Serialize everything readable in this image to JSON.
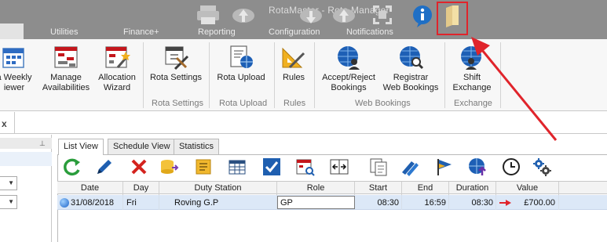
{
  "window": {
    "title": "RotaMaster - Rota Manager"
  },
  "tabs": [
    "Utilities",
    "Finance+",
    "Reporting",
    "Configuration",
    "Notifications"
  ],
  "ribbon": {
    "buttons": [
      {
        "line1": "a Weekly",
        "line2": "iewer"
      },
      {
        "line1": "Manage",
        "line2": "Availabilities"
      },
      {
        "line1": "Allocation",
        "line2": "Wizard"
      },
      {
        "line1": "Rota Settings",
        "line2": ""
      },
      {
        "line1": "Rota Upload",
        "line2": ""
      },
      {
        "line1": "Rules",
        "line2": ""
      },
      {
        "line1": "Accept/Reject",
        "line2": "Bookings"
      },
      {
        "line1": "Registrar",
        "line2": "Web Bookings"
      },
      {
        "line1": "Shift",
        "line2": "Exchange"
      }
    ],
    "groups": [
      "Rota Settings",
      "Rota Upload",
      "Rules",
      "Web Bookings",
      "Exchange"
    ]
  },
  "doc": {
    "close_glyph": "x"
  },
  "left_panel": {
    "pin_glyph": "⊥"
  },
  "view_tabs": [
    "List View",
    "Schedule View",
    "Statistics"
  ],
  "grid": {
    "headers": [
      "Date",
      "Day",
      "Duty Station",
      "Role",
      "Start",
      "End",
      "Duration",
      "Value"
    ],
    "rows": [
      {
        "date": "31/08/2018",
        "day": "Fri",
        "duty_station": "Roving G.P",
        "role": "GP",
        "start": "08:30",
        "end": "16:59",
        "duration": "08:30",
        "value": "£700.00"
      }
    ]
  },
  "colors": {
    "accent_red": "#e0242b",
    "selection": "#dce8f7",
    "ribbon_bg": "#f7f7f7",
    "titlebar": "#8d8d8d"
  },
  "icons": {
    "qat": [
      "printer-icon",
      "cloud-upload-icon",
      "cloud-download-icon",
      "cloud-upload-icon",
      "grid-focus-icon",
      "info-icon",
      "folder-icon"
    ],
    "toolbar": [
      "refresh-icon",
      "edit-icon",
      "delete-icon",
      "database-export-icon",
      "document-list-icon",
      "table-icon",
      "checkbox-icon",
      "calendar-search-icon",
      "swap-columns-icon",
      "copy-icon",
      "edit-multiple-icon",
      "flag-icon",
      "globe-upload-icon",
      "clock-icon",
      "settings-icon"
    ]
  }
}
